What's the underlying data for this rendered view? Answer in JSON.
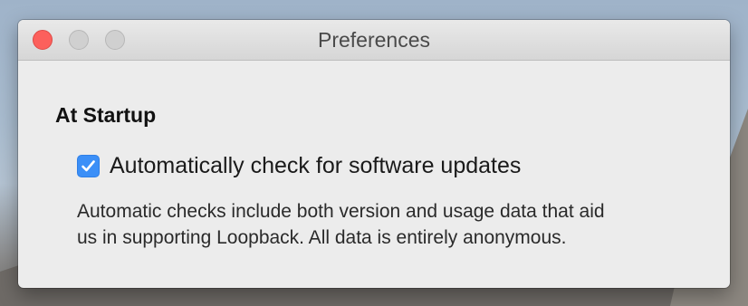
{
  "window": {
    "title": "Preferences"
  },
  "section": {
    "heading": "At Startup"
  },
  "auto_update": {
    "label": "Automatically check for software updates",
    "checked": true,
    "accent_color": "#3b8ff7"
  },
  "description": {
    "line1": "Automatic checks include both version and usage data that aid",
    "line2": "us in supporting Loopback. All data is entirely anonymous."
  },
  "traffic_lights": {
    "close_color": "#fc605c",
    "inactive_color": "#d0d0d0"
  }
}
